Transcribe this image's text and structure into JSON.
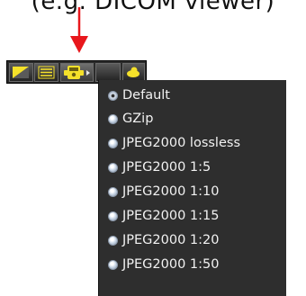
{
  "caption": {
    "text": "(e.g. DICOM viewer)"
  },
  "toolbar": {
    "buttons": [
      {
        "icon": "triangle-tool-icon"
      },
      {
        "icon": "list-lines-icon"
      },
      {
        "icon": "compression-gear-icon"
      },
      {
        "icon": "blank-icon"
      },
      {
        "icon": "cloud-icon"
      }
    ]
  },
  "menu": {
    "selected": "Default",
    "items": [
      {
        "label": "Default"
      },
      {
        "label": "GZip"
      },
      {
        "label": "JPEG2000 lossless"
      },
      {
        "label": "JPEG2000 1:5"
      },
      {
        "label": "JPEG2000 1:10"
      },
      {
        "label": "JPEG2000 1:15"
      },
      {
        "label": "JPEG2000 1:20"
      },
      {
        "label": "JPEG2000 1:50"
      }
    ]
  },
  "colors": {
    "arrow": "#e8171c",
    "menu_bg": "#2e2e2e",
    "menu_text": "#f2f2f2",
    "icon_yellow": "#f5e12a"
  }
}
